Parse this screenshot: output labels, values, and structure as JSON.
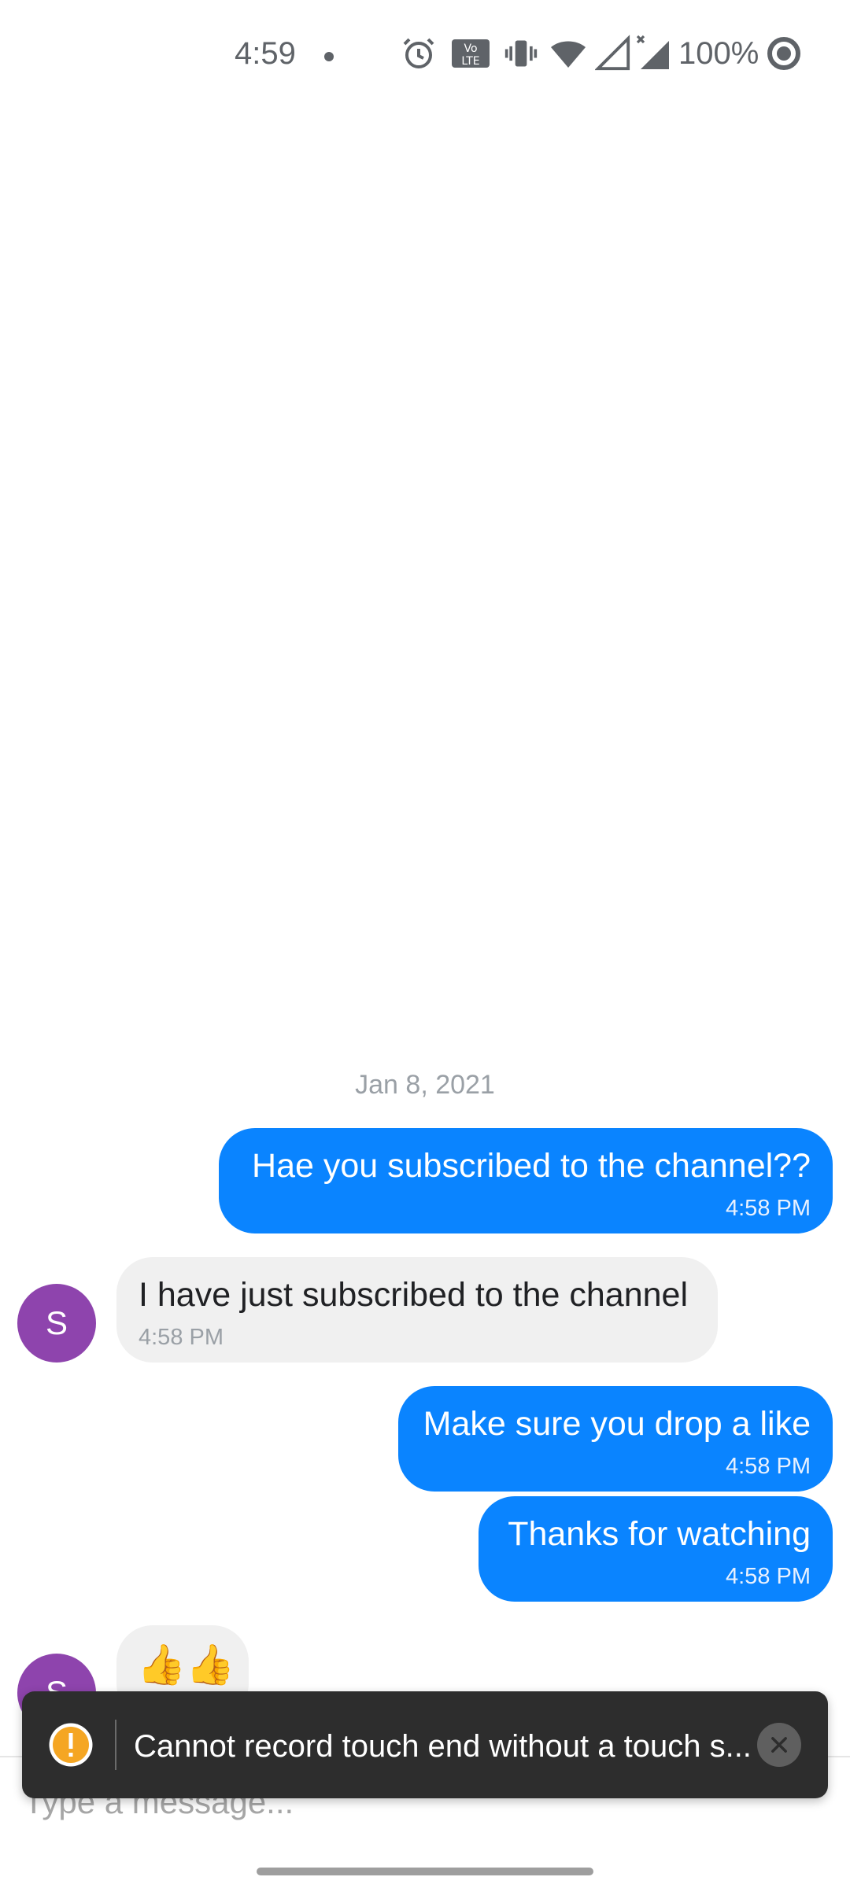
{
  "status_bar": {
    "time": "4:59",
    "battery": "100%",
    "icons": [
      "notification-dot-icon",
      "alarm-icon",
      "volte-icon",
      "vibrate-icon",
      "wifi-icon",
      "signal-icon",
      "signal-no-data-icon",
      "battery-saver-icon"
    ]
  },
  "conversation": {
    "date": "Jan 8, 2021",
    "messages": [
      {
        "direction": "outgoing",
        "text": "Hae you subscribed to the channel??",
        "time": "4:58 PM"
      },
      {
        "direction": "incoming",
        "avatar": "S",
        "text": "I have just subscribed to the channel",
        "time": "4:58 PM"
      },
      {
        "direction": "outgoing",
        "text": "Make sure you drop a like",
        "time": "4:58 PM"
      },
      {
        "direction": "outgoing",
        "text": "Thanks for watching",
        "time": "4:58 PM"
      },
      {
        "direction": "incoming",
        "avatar": "S",
        "text": "👍👍"
      }
    ]
  },
  "composer": {
    "placeholder": "Type a message..."
  },
  "snackbar": {
    "message": "Cannot record touch end without a touch s...",
    "icon": "warning-icon",
    "close_icon": "close-icon"
  },
  "colors": {
    "outgoing_bubble": "#0a84ff",
    "incoming_bubble": "#f0f0f0",
    "avatar": "#8e44ad",
    "snackbar_bg": "#2d2d2d",
    "warning": "#f5a623"
  }
}
